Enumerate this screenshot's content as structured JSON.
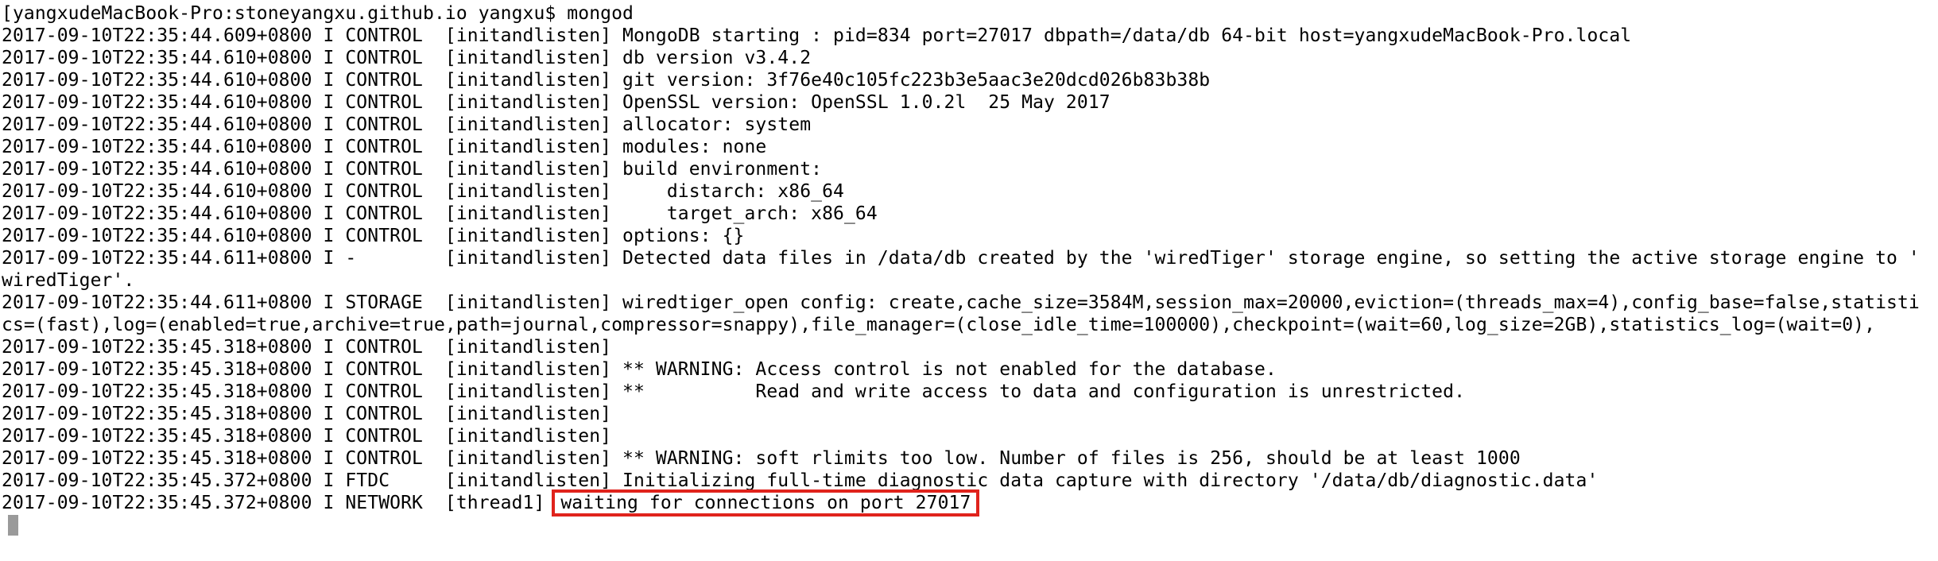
{
  "terminal": {
    "prompt_line": "[yangxudeMacBook-Pro:stoneyangxu.github.io yangxu$ mongod",
    "log_lines": [
      "2017-09-10T22:35:44.609+0800 I CONTROL  [initandlisten] MongoDB starting : pid=834 port=27017 dbpath=/data/db 64-bit host=yangxudeMacBook-Pro.local",
      "2017-09-10T22:35:44.610+0800 I CONTROL  [initandlisten] db version v3.4.2",
      "2017-09-10T22:35:44.610+0800 I CONTROL  [initandlisten] git version: 3f76e40c105fc223b3e5aac3e20dcd026b83b38b",
      "2017-09-10T22:35:44.610+0800 I CONTROL  [initandlisten] OpenSSL version: OpenSSL 1.0.2l  25 May 2017",
      "2017-09-10T22:35:44.610+0800 I CONTROL  [initandlisten] allocator: system",
      "2017-09-10T22:35:44.610+0800 I CONTROL  [initandlisten] modules: none",
      "2017-09-10T22:35:44.610+0800 I CONTROL  [initandlisten] build environment:",
      "2017-09-10T22:35:44.610+0800 I CONTROL  [initandlisten]     distarch: x86_64",
      "2017-09-10T22:35:44.610+0800 I CONTROL  [initandlisten]     target_arch: x86_64",
      "2017-09-10T22:35:44.610+0800 I CONTROL  [initandlisten] options: {}",
      "2017-09-10T22:35:44.611+0800 I -        [initandlisten] Detected data files in /data/db created by the 'wiredTiger' storage engine, so setting the active storage engine to '",
      "wiredTiger'.",
      "2017-09-10T22:35:44.611+0800 I STORAGE  [initandlisten] wiredtiger_open config: create,cache_size=3584M,session_max=20000,eviction=(threads_max=4),config_base=false,statisti",
      "cs=(fast),log=(enabled=true,archive=true,path=journal,compressor=snappy),file_manager=(close_idle_time=100000),checkpoint=(wait=60,log_size=2GB),statistics_log=(wait=0),",
      "2017-09-10T22:35:45.318+0800 I CONTROL  [initandlisten]",
      "2017-09-10T22:35:45.318+0800 I CONTROL  [initandlisten] ** WARNING: Access control is not enabled for the database.",
      "2017-09-10T22:35:45.318+0800 I CONTROL  [initandlisten] **          Read and write access to data and configuration is unrestricted.",
      "2017-09-10T22:35:45.318+0800 I CONTROL  [initandlisten]",
      "2017-09-10T22:35:45.318+0800 I CONTROL  [initandlisten]",
      "2017-09-10T22:35:45.318+0800 I CONTROL  [initandlisten] ** WARNING: soft rlimits too low. Number of files is 256, should be at least 1000",
      "2017-09-10T22:35:45.372+0800 I FTDC     [initandlisten] Initializing full-time diagnostic data capture with directory '/data/db/diagnostic.data'"
    ],
    "last_line_prefix": "2017-09-10T22:35:45.372+0800 I NETWORK  [thread1] ",
    "last_line_highlight": "waiting for connections on port 27017",
    "highlight_color": "#e0231c"
  }
}
